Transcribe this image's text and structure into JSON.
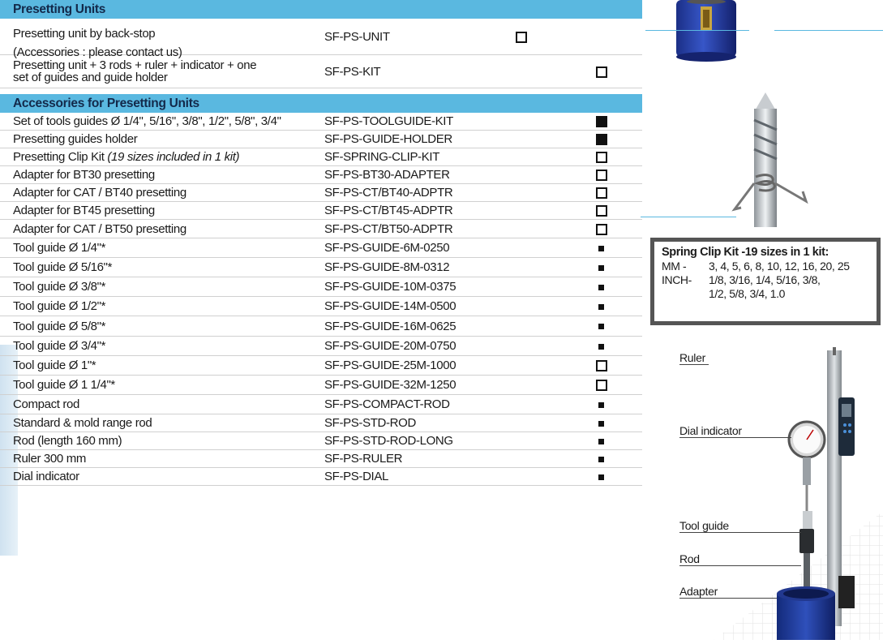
{
  "sections": [
    {
      "title": "Presetting Units",
      "rows": [
        {
          "desc_lines": [
            "Presetting unit by back-stop",
            "(Accessories : please contact us)"
          ],
          "code": "SF-PS-UNIT",
          "symbol": "empty",
          "col": 1
        },
        {
          "desc_lines": [
            "Presetting unit + 3 rods + ruler + indicator + one",
            "set of guides and guide holder"
          ],
          "code": "SF-PS-KIT",
          "symbol": "empty",
          "col": 2
        }
      ]
    },
    {
      "title": "Accessories for Presetting Units",
      "rows": [
        {
          "desc": "Set of tools guides Ø 1/4\", 5/16\", 3/8\", 1/2\", 5/8\", 3/4\"",
          "code": "SF-PS-TOOLGUIDE-KIT",
          "symbol": "filled"
        },
        {
          "desc": "Presetting guides holder",
          "code": "SF-PS-GUIDE-HOLDER",
          "symbol": "filled"
        },
        {
          "desc": "Presetting Clip Kit ",
          "desc_italic": "(19 sizes included in 1 kit)",
          "code": "SF-SPRING-CLIP-KIT",
          "symbol": "empty"
        },
        {
          "desc": "Adapter for BT30 presetting",
          "code": "SF-PS-BT30-ADAPTER",
          "symbol": "empty"
        },
        {
          "desc": "Adapter for CAT / BT40 presetting",
          "code": "SF-PS-CT/BT40-ADPTR",
          "symbol": "empty"
        },
        {
          "desc": "Adapter for BT45 presetting",
          "code": "SF-PS-CT/BT45-ADPTR",
          "symbol": "empty"
        },
        {
          "desc": "Adapter for CAT / BT50 presetting",
          "code": "SF-PS-CT/BT50-ADPTR",
          "symbol": "empty"
        },
        {
          "desc": "Tool guide  Ø 1/4\"*",
          "code": "SF-PS-GUIDE-6M-0250",
          "symbol": "small"
        },
        {
          "desc": "Tool guide  Ø 5/16\"*",
          "code": "SF-PS-GUIDE-8M-0312",
          "symbol": "small"
        },
        {
          "desc": "Tool guide  Ø 3/8\"*",
          "code": "SF-PS-GUIDE-10M-0375",
          "symbol": "small"
        },
        {
          "desc": "Tool guide  Ø 1/2\"*",
          "code": "SF-PS-GUIDE-14M-0500",
          "symbol": "small"
        },
        {
          "desc": "Tool guide  Ø 5/8\"*",
          "code": "SF-PS-GUIDE-16M-0625",
          "symbol": "small"
        },
        {
          "desc": "Tool guide  Ø 3/4\"*",
          "code": "SF-PS-GUIDE-20M-0750",
          "symbol": "small"
        },
        {
          "desc": "Tool guide  Ø 1\"*",
          "code": "SF-PS-GUIDE-25M-1000",
          "symbol": "empty"
        },
        {
          "desc": "Tool guide  Ø 1 1/4\"*",
          "code": "SF-PS-GUIDE-32M-1250",
          "symbol": "empty"
        },
        {
          "desc": "Compact rod",
          "code": "SF-PS-COMPACT-ROD",
          "symbol": "small"
        },
        {
          "desc": "Standard & mold range rod",
          "code": "SF-PS-STD-ROD",
          "symbol": "small"
        },
        {
          "desc": "Rod (length 160 mm)",
          "code": "SF-PS-STD-ROD-LONG",
          "symbol": "small"
        },
        {
          "desc": "Ruler 300 mm",
          "code": "SF-PS-RULER",
          "symbol": "small"
        },
        {
          "desc": "Dial indicator",
          "code": "SF-PS-DIAL",
          "symbol": "small"
        }
      ]
    }
  ],
  "clip_kit": {
    "title": "Spring Clip Kit -19 sizes in 1 kit:",
    "mm_label": "MM  -",
    "mm_values": "3, 4, 5, 6, 8, 10, 12, 16, 20, 25",
    "inch_label": "INCH-",
    "inch_values_1": "1/8, 3/16, 1/4, 5/16, 3/8,",
    "inch_values_2": "1/2, 5/8, 3/4, 1.0"
  },
  "callouts": {
    "ruler": "Ruler",
    "dial": "Dial indicator",
    "tool_guide": "Tool guide",
    "rod": "Rod",
    "adapter": "Adapter"
  }
}
